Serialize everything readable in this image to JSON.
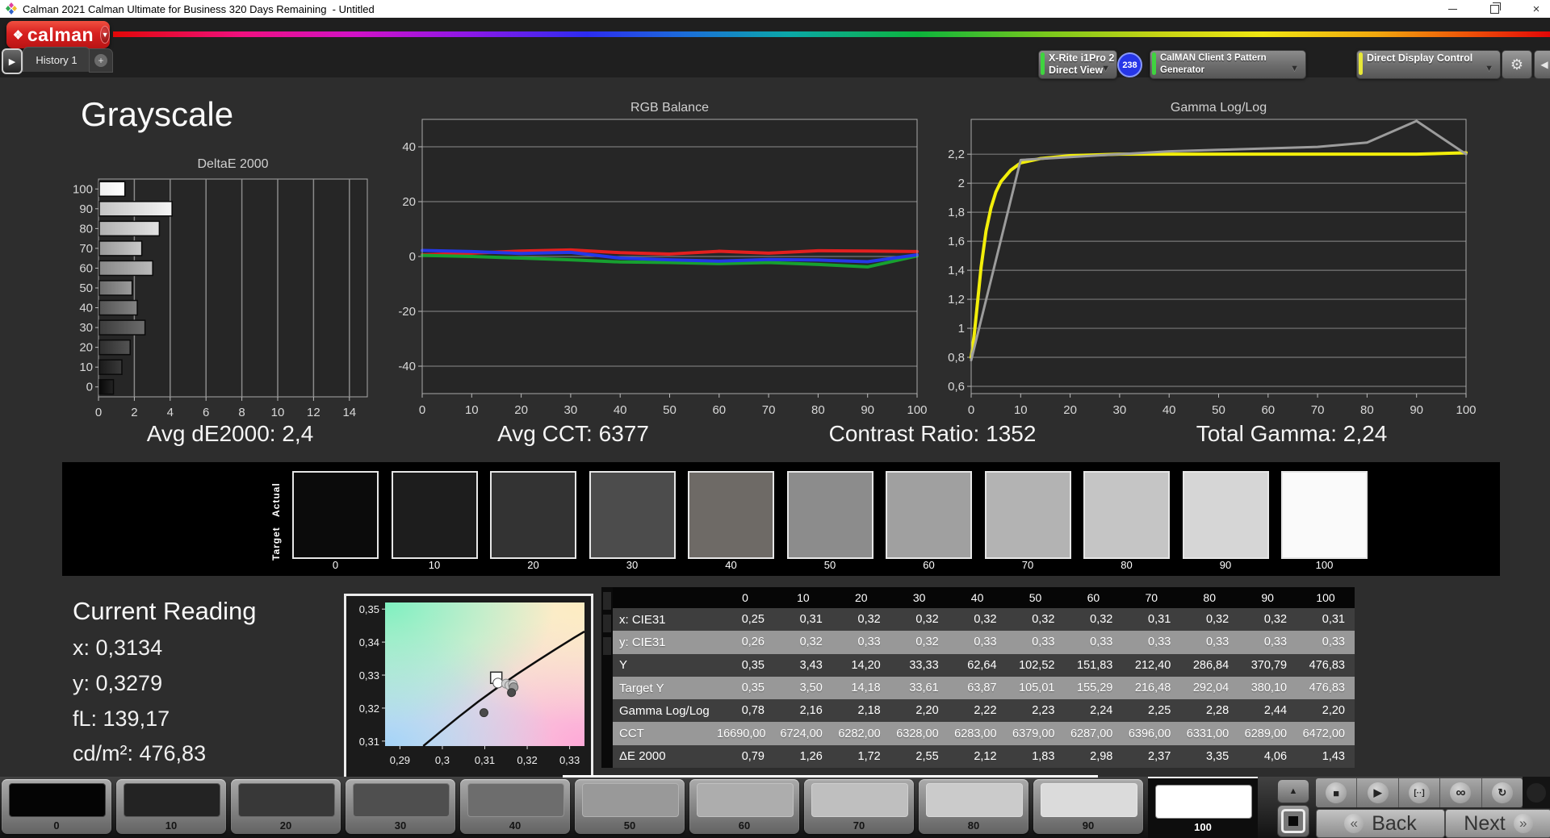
{
  "title_bar": {
    "title": "Calman 2021 Calman Ultimate for Business 320 Days Remaining  - Untitled"
  },
  "header": {
    "logo": {
      "text": "calman",
      "accent": "#d82020"
    },
    "history_tab": {
      "label": "History 1",
      "add": "+"
    },
    "toolbar": {
      "meter": {
        "line1": "X-Rite i1Pro 2",
        "line2": "Direct View",
        "status_color": "#3fd43f",
        "badge": "238",
        "badge_color": "#2636e8"
      },
      "source": {
        "label": "CalMAN Client 3 Pattern Generator",
        "status_color": "#3fd43f"
      },
      "display": {
        "label": "Direct Display Control",
        "status_color": "#e8e838"
      }
    }
  },
  "page_title": "Grayscale",
  "summary": [
    "Avg dE2000: 2,4",
    "Avg CCT: 6377",
    "Contrast Ratio: 1352",
    "Total Gamma: 2,24"
  ],
  "current_reading": {
    "heading": "Current Reading",
    "lines": [
      "x: 0,3134",
      "y: 0,3279",
      "fL: 139,17",
      "cd/m²: 476,83"
    ]
  },
  "strip": {
    "actual": "Actual",
    "target": "Target",
    "swatches": [
      {
        "label": "0",
        "color": "#0b0b0b"
      },
      {
        "label": "10",
        "color": "#1d1d1d"
      },
      {
        "label": "20",
        "color": "#333333"
      },
      {
        "label": "30",
        "color": "#4c4c4c"
      },
      {
        "label": "40",
        "color": "#6e6a66"
      },
      {
        "label": "50",
        "color": "#8c8c8c"
      },
      {
        "label": "60",
        "color": "#a0a0a0"
      },
      {
        "label": "70",
        "color": "#b3b3b3"
      },
      {
        "label": "80",
        "color": "#c5c5c5"
      },
      {
        "label": "90",
        "color": "#d6d6d6"
      },
      {
        "label": "100",
        "color": "#fafafa"
      }
    ]
  },
  "table": {
    "header": [
      "0",
      "10",
      "20",
      "30",
      "40",
      "50",
      "60",
      "70",
      "80",
      "90",
      "100"
    ],
    "rows": [
      {
        "label": "x: CIE31",
        "values": [
          "0,25",
          "0,31",
          "0,32",
          "0,32",
          "0,32",
          "0,32",
          "0,32",
          "0,31",
          "0,32",
          "0,32",
          "0,31"
        ]
      },
      {
        "label": "y: CIE31",
        "values": [
          "0,26",
          "0,32",
          "0,33",
          "0,32",
          "0,33",
          "0,33",
          "0,33",
          "0,33",
          "0,33",
          "0,33",
          "0,33"
        ]
      },
      {
        "label": "Y",
        "values": [
          "0,35",
          "3,43",
          "14,20",
          "33,33",
          "62,64",
          "102,52",
          "151,83",
          "212,40",
          "286,84",
          "370,79",
          "476,83"
        ]
      },
      {
        "label": "Target Y",
        "values": [
          "0,35",
          "3,50",
          "14,18",
          "33,61",
          "63,87",
          "105,01",
          "155,29",
          "216,48",
          "292,04",
          "380,10",
          "476,83"
        ]
      },
      {
        "label": "Gamma Log/Log",
        "values": [
          "0,78",
          "2,16",
          "2,18",
          "2,20",
          "2,22",
          "2,23",
          "2,24",
          "2,25",
          "2,28",
          "2,44",
          "2,20"
        ]
      },
      {
        "label": "CCT",
        "values": [
          "16690,00",
          "6724,00",
          "6282,00",
          "6328,00",
          "6283,00",
          "6379,00",
          "6287,00",
          "6396,00",
          "6331,00",
          "6289,00",
          "6472,00"
        ]
      },
      {
        "label": "ΔE 2000",
        "values": [
          "0,79",
          "1,26",
          "1,72",
          "2,55",
          "2,12",
          "1,83",
          "2,98",
          "2,37",
          "3,35",
          "4,06",
          "1,43"
        ]
      }
    ]
  },
  "bottom": {
    "patches": [
      {
        "label": "0",
        "color": "#040404"
      },
      {
        "label": "10",
        "color": "#232323"
      },
      {
        "label": "20",
        "color": "#383838"
      },
      {
        "label": "30",
        "color": "#4f4f4f"
      },
      {
        "label": "40",
        "color": "#6d6d6d"
      },
      {
        "label": "50",
        "color": "#999999"
      },
      {
        "label": "60",
        "color": "#adadad"
      },
      {
        "label": "70",
        "color": "#bfbfbf"
      },
      {
        "label": "80",
        "color": "#cbcbcb"
      },
      {
        "label": "90",
        "color": "#dbdbdb"
      },
      {
        "label": "100",
        "color": "#ffffff"
      }
    ],
    "selected_index": 10,
    "transport": [
      {
        "name": "stop-icon",
        "glyph": "■"
      },
      {
        "name": "play-icon",
        "glyph": "▶"
      },
      {
        "name": "pattern-window-icon",
        "glyph": "[··]"
      },
      {
        "name": "continuous-icon",
        "glyph": "∞"
      },
      {
        "name": "refresh-icon",
        "glyph": "↻"
      }
    ],
    "back": "Back",
    "next": "Next"
  },
  "chart_data": [
    {
      "id": "deltae",
      "type": "bar",
      "title": "DeltaE 2000",
      "orientation": "horizontal",
      "categories": [
        "100",
        "90",
        "80",
        "70",
        "60",
        "50",
        "40",
        "30",
        "20",
        "10",
        "0"
      ],
      "values": [
        1.43,
        4.06,
        3.35,
        2.37,
        2.98,
        1.83,
        2.12,
        2.55,
        1.72,
        1.26,
        0.79
      ],
      "xlim": [
        0,
        15
      ],
      "xticks": [
        0,
        2,
        4,
        6,
        8,
        10,
        12,
        14
      ],
      "bar_colors": [
        [
          "#f0f0f0",
          "#ffffff"
        ],
        [
          "#c4c4c4",
          "#f4f4f4"
        ],
        [
          "#b0b0b0",
          "#e2e2e2"
        ],
        [
          "#989898",
          "#cacaca"
        ],
        [
          "#888888",
          "#bababa"
        ],
        [
          "#6c6c6c",
          "#9c9c9c"
        ],
        [
          "#545454",
          "#848484"
        ],
        [
          "#3c3c3c",
          "#6c6c6c"
        ],
        [
          "#2e2e2e",
          "#545454"
        ],
        [
          "#1a1a1a",
          "#3a3a3a"
        ],
        [
          "#080808",
          "#242424"
        ]
      ]
    },
    {
      "id": "rgb",
      "type": "line",
      "title": "RGB Balance",
      "xlim": [
        0,
        100
      ],
      "xticks": [
        0,
        10,
        20,
        30,
        40,
        50,
        60,
        70,
        80,
        90,
        100
      ],
      "ylim": [
        -50,
        50
      ],
      "yticks": [
        {
          "v": 40,
          "label": "40"
        },
        {
          "v": 20,
          "label": "20"
        },
        {
          "v": 0,
          "label": "0"
        },
        {
          "v": -20,
          "label": "-20"
        },
        {
          "v": -40,
          "label": "-40"
        }
      ],
      "series": [
        {
          "name": "Red balance",
          "color": "#e32020",
          "width": 4,
          "x": [
            0,
            10,
            20,
            30,
            40,
            50,
            60,
            70,
            80,
            90,
            100
          ],
          "values": [
            0.6,
            1.2,
            2.0,
            2.4,
            1.4,
            0.9,
            1.9,
            1.2,
            2.1,
            2.0,
            1.8
          ]
        },
        {
          "name": "Green balance",
          "color": "#17a030",
          "width": 4,
          "x": [
            0,
            10,
            20,
            30,
            40,
            50,
            60,
            70,
            80,
            90,
            100
          ],
          "values": [
            0.4,
            0.0,
            -0.6,
            -1.2,
            -2.0,
            -2.2,
            -2.6,
            -2.2,
            -2.9,
            -3.8,
            0.2
          ]
        },
        {
          "name": "Blue balance",
          "color": "#2438e8",
          "width": 4,
          "x": [
            0,
            10,
            20,
            30,
            40,
            50,
            60,
            70,
            80,
            90,
            100
          ],
          "values": [
            2.2,
            1.8,
            1.1,
            1.5,
            -0.6,
            -1.2,
            -1.7,
            -1.1,
            -1.3,
            -1.9,
            0.6
          ]
        }
      ]
    },
    {
      "id": "gamma",
      "type": "line",
      "title": "Gamma Log/Log",
      "xlim": [
        0,
        100
      ],
      "xticks": [
        0,
        10,
        20,
        30,
        40,
        50,
        60,
        70,
        80,
        90,
        100
      ],
      "ylim": [
        0.55,
        2.44
      ],
      "yticks": [
        {
          "v": 2.2,
          "label": "2,2"
        },
        {
          "v": 2.0,
          "label": "2"
        },
        {
          "v": 1.8,
          "label": "1,8"
        },
        {
          "v": 1.6,
          "label": "1,6"
        },
        {
          "v": 1.4,
          "label": "1,4"
        },
        {
          "v": 1.2,
          "label": "1,2"
        },
        {
          "v": 1.0,
          "label": "1"
        },
        {
          "v": 0.8,
          "label": "0,8"
        },
        {
          "v": 0.6,
          "label": "0,6"
        }
      ],
      "series": [
        {
          "name": "Target gamma",
          "color": "#f2ee0a",
          "width": 4,
          "x": [
            0,
            0.6,
            1.2,
            2,
            3,
            4,
            5,
            6,
            8,
            10,
            14,
            20,
            30,
            40,
            50,
            60,
            70,
            80,
            90,
            100
          ],
          "values": [
            0.8,
            0.95,
            1.15,
            1.42,
            1.67,
            1.83,
            1.94,
            2.01,
            2.09,
            2.14,
            2.17,
            2.19,
            2.2,
            2.2,
            2.2,
            2.2,
            2.2,
            2.2,
            2.2,
            2.21
          ]
        },
        {
          "name": "Measured gamma",
          "color": "#9c9c9c",
          "width": 3,
          "x": [
            0,
            10,
            20,
            30,
            40,
            50,
            60,
            70,
            80,
            90,
            100
          ],
          "values": [
            0.78,
            2.16,
            2.18,
            2.2,
            2.22,
            2.23,
            2.24,
            2.25,
            2.28,
            2.44,
            2.2
          ]
        }
      ]
    },
    {
      "id": "cie",
      "type": "scatter",
      "title": "CIE xy white point",
      "xlim": [
        0.2865,
        0.3335
      ],
      "ylim": [
        0.3085,
        0.352
      ],
      "xticks": [
        {
          "v": 0.29,
          "label": "0,29"
        },
        {
          "v": 0.3,
          "label": "0,3"
        },
        {
          "v": 0.31,
          "label": "0,31"
        },
        {
          "v": 0.32,
          "label": "0,32"
        },
        {
          "v": 0.33,
          "label": "0,33"
        }
      ],
      "yticks": [
        {
          "v": 0.35,
          "label": "0,35"
        },
        {
          "v": 0.34,
          "label": "0,34"
        },
        {
          "v": 0.33,
          "label": "0,33"
        },
        {
          "v": 0.32,
          "label": "0,32"
        },
        {
          "v": 0.31,
          "label": "0,31"
        }
      ],
      "locus": [
        [
          0.2955,
          0.3085
        ],
        [
          0.2995,
          0.3128
        ],
        [
          0.304,
          0.3175
        ],
        [
          0.3085,
          0.322
        ],
        [
          0.313,
          0.3262
        ],
        [
          0.3175,
          0.3302
        ],
        [
          0.322,
          0.334
        ],
        [
          0.3265,
          0.3377
        ],
        [
          0.331,
          0.3413
        ],
        [
          0.3335,
          0.3432
        ]
      ],
      "target_marker": {
        "x": 0.3127,
        "y": 0.3292
      },
      "points": [
        {
          "x": 0.3131,
          "y": 0.3276,
          "style": "current"
        },
        {
          "x": 0.315,
          "y": 0.3274,
          "style": "history"
        },
        {
          "x": 0.3158,
          "y": 0.3269,
          "style": "history"
        },
        {
          "x": 0.3166,
          "y": 0.3272,
          "style": "history"
        },
        {
          "x": 0.3168,
          "y": 0.3263,
          "style": "mid"
        },
        {
          "x": 0.3163,
          "y": 0.3247,
          "style": "dark"
        },
        {
          "x": 0.3098,
          "y": 0.3186,
          "style": "dark"
        }
      ]
    }
  ]
}
